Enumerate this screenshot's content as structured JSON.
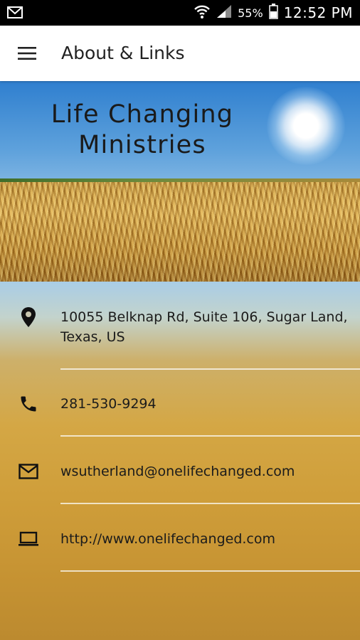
{
  "status_bar": {
    "battery_percent": "55%",
    "time": "12:52 PM",
    "icons": [
      "mail-icon",
      "wifi-icon",
      "signal-icon",
      "battery-icon"
    ]
  },
  "app_bar": {
    "title": "About & Links",
    "menu_icon": "hamburger-menu-icon"
  },
  "banner": {
    "line1": "Life Changing",
    "line2": "Ministries"
  },
  "contacts": [
    {
      "icon": "location-pin-icon",
      "text": "10055 Belknap Rd, Suite 106, Sugar Land, Texas, US"
    },
    {
      "icon": "phone-icon",
      "text": "281-530-9294"
    },
    {
      "icon": "email-icon",
      "text": "wsutherland@onelifechanged.com"
    },
    {
      "icon": "laptop-icon",
      "text": "http://www.onelifechanged.com"
    }
  ]
}
